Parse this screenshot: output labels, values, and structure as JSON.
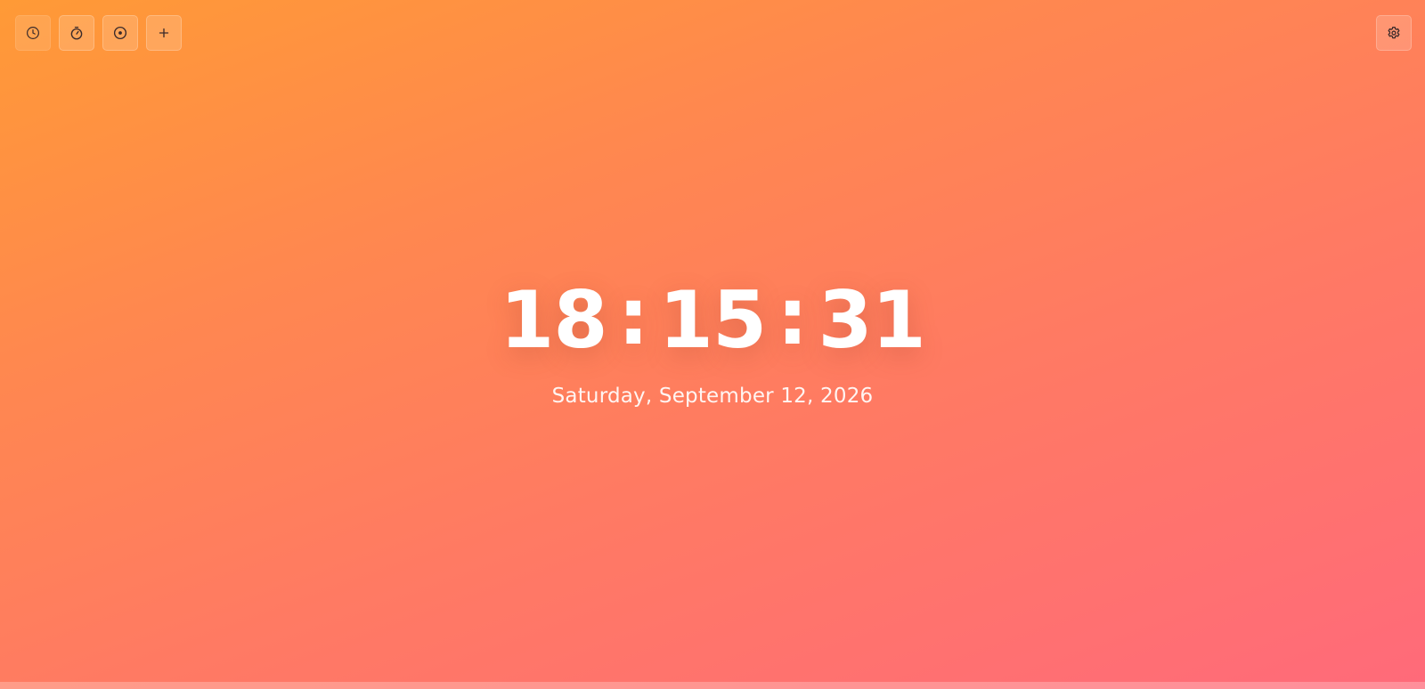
{
  "toolbar": {
    "buttons": [
      {
        "icon": "clock-icon",
        "label": "Clock"
      },
      {
        "icon": "stopwatch-icon",
        "label": "Stopwatch"
      },
      {
        "icon": "timer-icon",
        "label": "Timer"
      },
      {
        "icon": "plus-icon",
        "label": "Add"
      }
    ]
  },
  "settings": {
    "icon": "gear-icon"
  },
  "clock": {
    "hours": "18",
    "minutes": "15",
    "seconds": "31",
    "separator": ":"
  },
  "date": {
    "text": "Saturday, September 12, 2026"
  },
  "colors": {
    "gradient_start": "#ff9a36",
    "gradient_end": "#ff6a7a",
    "text": "#ffffff",
    "icon": "#3a2a2a"
  }
}
